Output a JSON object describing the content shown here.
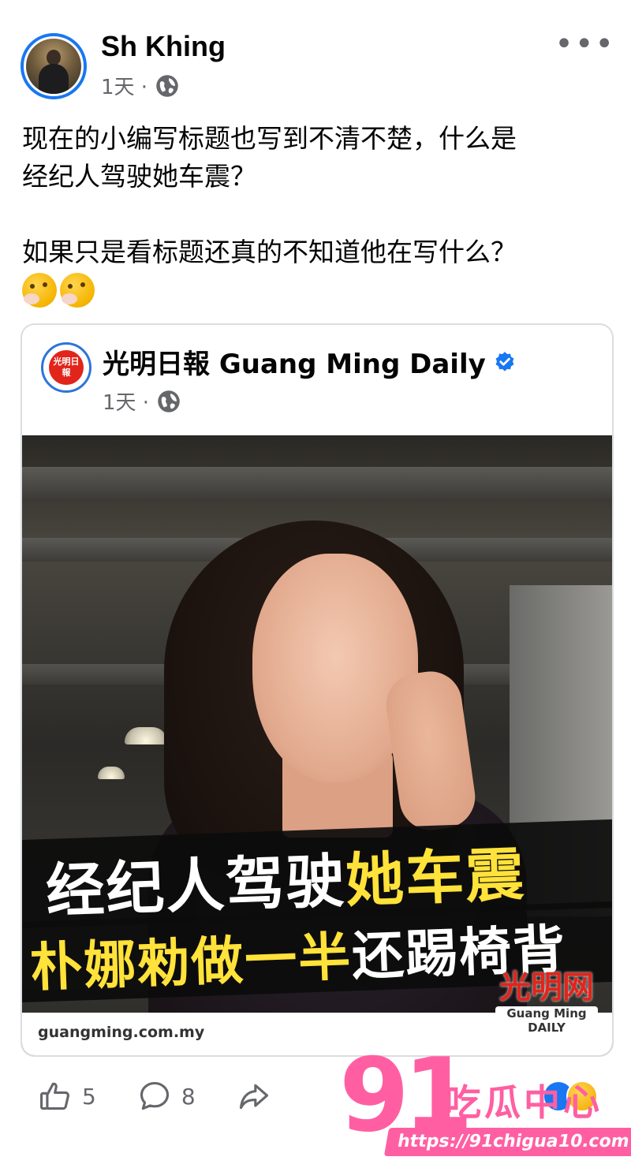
{
  "post": {
    "author": "Sh Khing",
    "time": "1天 ·",
    "text_lines": [
      "现在的小编写标题也写到不清不楚，什么是",
      "经纪人驾驶她车震？",
      "如果只是看标题还真的不知道他在写什么？"
    ],
    "more_label": "•••"
  },
  "shared": {
    "page_name": "光明日報 Guang Ming Daily",
    "logo_text": "光明日報",
    "time": "1天 ·",
    "headline_1_white": "经纪人驾驶",
    "headline_1_yellow": "她车震",
    "headline_2_yellow": "朴娜勑做一半",
    "headline_2_white": "还踢椅背",
    "source_url": "guangming.com.my",
    "brand_cn": "光明网",
    "brand_en": "Guang Ming DAILY"
  },
  "actions": {
    "like_count": "5",
    "comment_count": "8"
  },
  "watermark": {
    "number": "91",
    "name": "吃瓜中心",
    "url": "https://91chigua10.com"
  },
  "colors": {
    "accent": "#1877f2",
    "headline_yellow": "#ffe23a",
    "watermark_pink": "#ff5fa2",
    "secondary_text": "#65676b"
  }
}
